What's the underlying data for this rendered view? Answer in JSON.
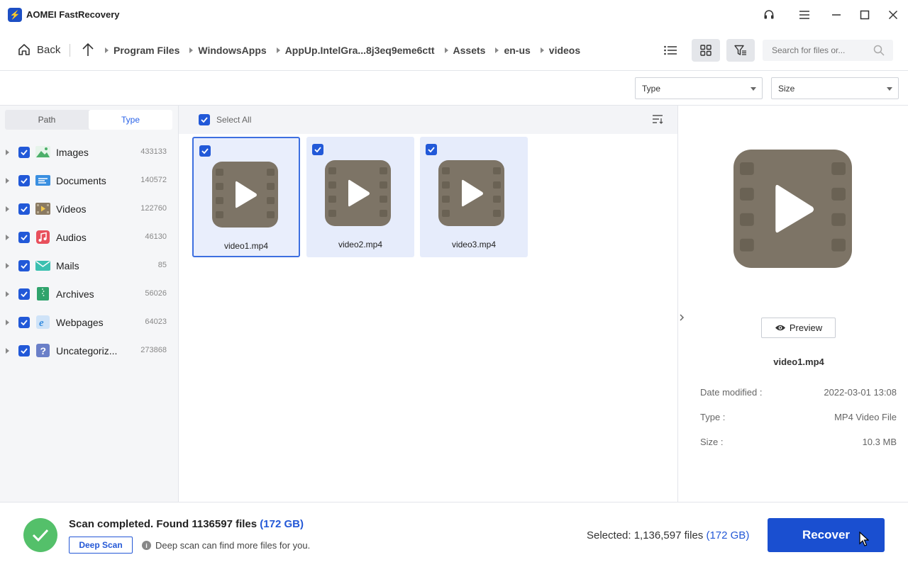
{
  "app": {
    "title": "AOMEI FastRecovery"
  },
  "toolbar": {
    "back_label": "Back",
    "breadcrumbs": [
      "Program Files",
      "WindowsApps",
      "AppUp.IntelGra...8j3eq9eme6ctt",
      "Assets",
      "en-us",
      "videos"
    ],
    "search_placeholder": "Search for files or..."
  },
  "filters": {
    "type_label": "Type",
    "size_label": "Size"
  },
  "left_panel": {
    "tabs": [
      {
        "label": "Path"
      },
      {
        "label": "Type"
      }
    ],
    "active_tab": "Type",
    "categories": [
      {
        "name": "Images",
        "count": "433133",
        "color": "#4caf6a"
      },
      {
        "name": "Documents",
        "count": "140572",
        "color": "#3a8fe0"
      },
      {
        "name": "Videos",
        "count": "122760",
        "color": "#8a7a62"
      },
      {
        "name": "Audios",
        "count": "46130",
        "color": "#e8505c"
      },
      {
        "name": "Mails",
        "count": "85",
        "color": "#3cc0b0"
      },
      {
        "name": "Archives",
        "count": "56026",
        "color": "#2fa36c"
      },
      {
        "name": "Webpages",
        "count": "64023",
        "color": "#3a8fe0"
      },
      {
        "name": "Uncategoriz...",
        "count": "273868",
        "color": "#6a7fc8"
      }
    ]
  },
  "center": {
    "select_all_label": "Select All",
    "files": [
      {
        "name": "video1.mp4",
        "selected": true
      },
      {
        "name": "video2.mp4",
        "selected": false
      },
      {
        "name": "video3.mp4",
        "selected": false
      }
    ]
  },
  "preview": {
    "button_label": "Preview",
    "file_name": "video1.mp4",
    "meta": [
      {
        "label": "Date modified :",
        "value": "2022-03-01 13:08"
      },
      {
        "label": "Type :",
        "value": "MP4 Video File"
      },
      {
        "label": "Size :",
        "value": "10.3 MB"
      }
    ]
  },
  "footer": {
    "status_prefix": "Scan completed. Found 1136597 files ",
    "status_size": "(172 GB)",
    "deep_scan_label": "Deep Scan",
    "hint": "Deep scan can find more files for you.",
    "selected_prefix": "Selected: 1,136,597 files ",
    "selected_size": "(172 GB)",
    "recover_label": "Recover"
  },
  "colors": {
    "accent": "#1a4fd0",
    "success": "#54c06a",
    "video_thumb": "#7d7466"
  },
  "icons": [
    "headset-icon",
    "menu-icon",
    "minimize-icon",
    "maximize-icon",
    "close-icon",
    "home-icon",
    "arrow-up-icon",
    "list-view-icon",
    "grid-view-icon",
    "filter-icon",
    "search-icon",
    "sort-icon",
    "eye-icon",
    "check-icon",
    "info-icon",
    "chevron-right-icon"
  ]
}
